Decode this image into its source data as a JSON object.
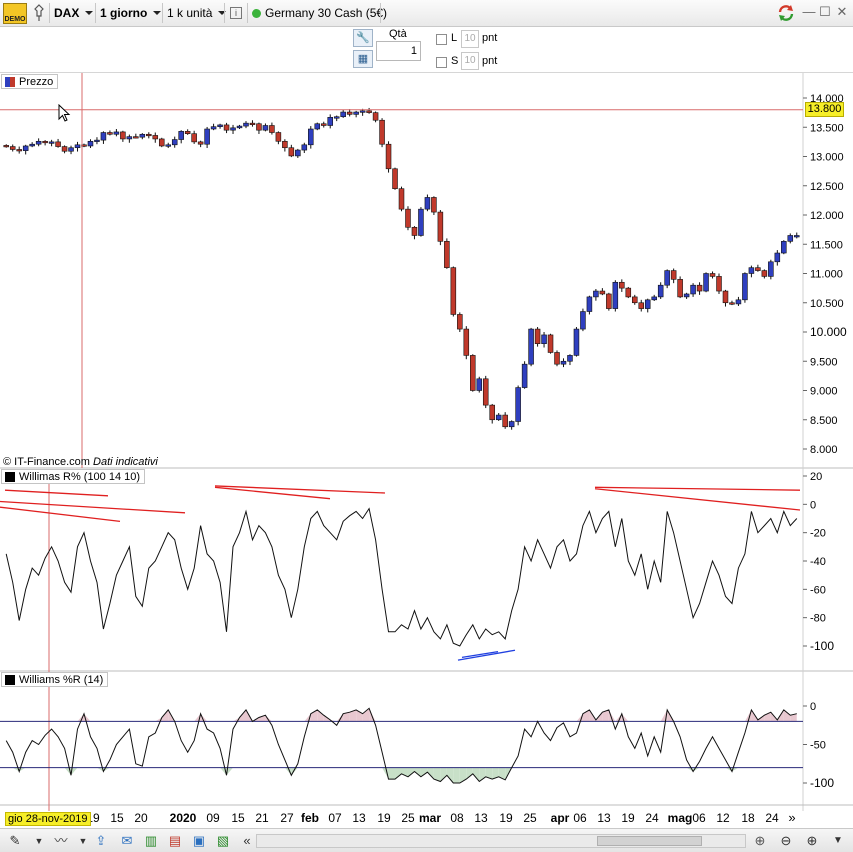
{
  "toolbar": {
    "demo_label": "DEMO",
    "instrument": "DAX",
    "timeframe": "1 giorno",
    "units": "1 k unità",
    "product": "Germany 30 Cash (5€)"
  },
  "order": {
    "qty_label": "Qtà",
    "qty_value": "1",
    "long_label": "L",
    "short_label": "S",
    "long_pnt": "10",
    "short_pnt": "10",
    "pnt_label": "pnt"
  },
  "panels": {
    "price_legend": "Prezzo",
    "williams1_legend": "Willimas R% (100 14 10)",
    "williams2_legend": "Williams %R (14)",
    "credit_source": "© IT-Finance.com",
    "credit_note": "Dati indicativi",
    "cursor_date": "gio 28-nov-2019",
    "price_cursor_value": "13.800"
  },
  "colors": {
    "bull_candle": "#2f3fbf",
    "bear_candle": "#c0392b",
    "crosshair": "#d96b6b",
    "trendline_red": "#e02020",
    "trendline_blue": "#2040e0",
    "band_line": "#2a2a7a",
    "overbought_fill": "#e8c8d0",
    "oversold_fill": "#c8e0c8"
  },
  "chart_data": [
    {
      "type": "candlestick",
      "title": "Prezzo",
      "ylim": [
        7800,
        14200
      ],
      "yticks": [
        8000,
        8500,
        9000,
        9500,
        10000,
        10500,
        11000,
        11500,
        12000,
        12500,
        13000,
        13500,
        14000
      ],
      "ytick_labels": [
        "8.000",
        "8.500",
        "9.000",
        "9.500",
        "10.000",
        "10.500",
        "11.000",
        "11.500",
        "12.000",
        "12.500",
        "13.000",
        "13.500",
        "14.000"
      ],
      "crosshair_value": 13800,
      "close": [
        13170,
        13120,
        13100,
        13180,
        13210,
        13260,
        13240,
        13250,
        13170,
        13090,
        13150,
        13200,
        13180,
        13260,
        13280,
        13410,
        13380,
        13420,
        13300,
        13340,
        13330,
        13380,
        13360,
        13300,
        13180,
        13200,
        13290,
        13430,
        13390,
        13250,
        13210,
        13470,
        13510,
        13540,
        13450,
        13490,
        13520,
        13570,
        13560,
        13450,
        13530,
        13410,
        13260,
        13150,
        13010,
        13110,
        13200,
        13470,
        13560,
        13530,
        13670,
        13680,
        13760,
        13720,
        13760,
        13780,
        13750,
        13620,
        13210,
        12790,
        12450,
        12100,
        11790,
        11650,
        12100,
        12300,
        12050,
        11550,
        11100,
        10300,
        10050,
        9600,
        9000,
        9200,
        8750,
        8500,
        8580,
        8380,
        8470,
        9050,
        9450,
        10050,
        9800,
        9950,
        9650,
        9450,
        9500,
        9600,
        10050,
        10350,
        10600,
        10700,
        10650,
        10400,
        10850,
        10750,
        10600,
        10500,
        10400,
        10550,
        10600,
        10800,
        11050,
        10900,
        10600,
        10650,
        10800,
        10700,
        11000,
        10950,
        10700,
        10500,
        10480,
        10550,
        11000,
        11100,
        11050,
        10950,
        11200,
        11350,
        11550,
        11650,
        11650
      ],
      "x_tick_labels": [
        "19",
        "15",
        "20",
        "2020",
        "09",
        "15",
        "21",
        "27",
        "feb",
        "07",
        "13",
        "19",
        "25",
        "mar",
        "08",
        "13",
        "19",
        "25",
        "apr",
        "06",
        "13",
        "19",
        "24",
        "mag",
        "06",
        "12",
        "18",
        "24"
      ]
    },
    {
      "type": "line",
      "title": "Willimas R% (100 14 10)",
      "ylim": [
        -110,
        22
      ],
      "yticks": [
        20,
        0,
        -20,
        -40,
        -60,
        -80,
        -100
      ],
      "values": [
        -35,
        -55,
        -82,
        -60,
        -45,
        -50,
        -38,
        -30,
        -40,
        -55,
        -62,
        -30,
        -20,
        -40,
        -55,
        -88,
        -70,
        -50,
        -40,
        -30,
        -65,
        -72,
        -45,
        -40,
        -30,
        -20,
        -25,
        -45,
        -60,
        -45,
        -15,
        -35,
        -40,
        -55,
        -90,
        -30,
        -20,
        -5,
        -25,
        -15,
        -20,
        -30,
        -50,
        -60,
        -80,
        -60,
        -30,
        -10,
        -5,
        -15,
        -20,
        -25,
        -12,
        -8,
        -5,
        -10,
        -3,
        -25,
        -60,
        -90,
        -90,
        -85,
        -88,
        -75,
        -88,
        -80,
        -90,
        -95,
        -85,
        -98,
        -100,
        -92,
        -85,
        -95,
        -88,
        -92,
        -90,
        -95,
        -75,
        -60,
        -30,
        -40,
        -25,
        -35,
        -45,
        -30,
        -25,
        -40,
        -35,
        -15,
        -5,
        -20,
        -10,
        -5,
        -30,
        -10,
        -40,
        -50,
        -35,
        -60,
        -40,
        -55,
        -5,
        -20,
        -40,
        -60,
        -80,
        -70,
        -55,
        -40,
        -50,
        -65,
        -70,
        -45,
        -35,
        -5,
        -20,
        -15,
        -10,
        -20,
        -5,
        -15,
        -10
      ],
      "annotations": "red trend lines near the 0 level; blue trend lines near -100"
    },
    {
      "type": "line",
      "title": "Williams %R (14)",
      "ylim": [
        -110,
        5
      ],
      "yticks": [
        0,
        -50,
        -100
      ],
      "bands": [
        -20,
        -80
      ],
      "values": [
        -45,
        -60,
        -85,
        -60,
        -45,
        -50,
        -38,
        -30,
        -40,
        -55,
        -90,
        -30,
        -10,
        -40,
        -55,
        -85,
        -70,
        -50,
        -40,
        -30,
        -75,
        -78,
        -40,
        -35,
        -15,
        -5,
        -20,
        -45,
        -60,
        -45,
        -10,
        -30,
        -35,
        -55,
        -90,
        -30,
        -15,
        -5,
        -20,
        -15,
        -12,
        -25,
        -50,
        -70,
        -90,
        -75,
        -40,
        -10,
        -5,
        -12,
        -18,
        -25,
        -10,
        -8,
        -5,
        -10,
        -3,
        -25,
        -60,
        -95,
        -95,
        -88,
        -92,
        -85,
        -92,
        -86,
        -95,
        -98,
        -90,
        -100,
        -100,
        -95,
        -88,
        -98,
        -92,
        -95,
        -92,
        -96,
        -80,
        -65,
        -30,
        -40,
        -20,
        -35,
        -45,
        -28,
        -22,
        -40,
        -35,
        -10,
        -5,
        -18,
        -8,
        -5,
        -30,
        -10,
        -40,
        -55,
        -35,
        -65,
        -40,
        -60,
        -5,
        -20,
        -40,
        -70,
        -85,
        -72,
        -55,
        -40,
        -55,
        -70,
        -85,
        -60,
        -35,
        -5,
        -18,
        -12,
        -8,
        -18,
        -5,
        -12,
        -10
      ]
    }
  ]
}
